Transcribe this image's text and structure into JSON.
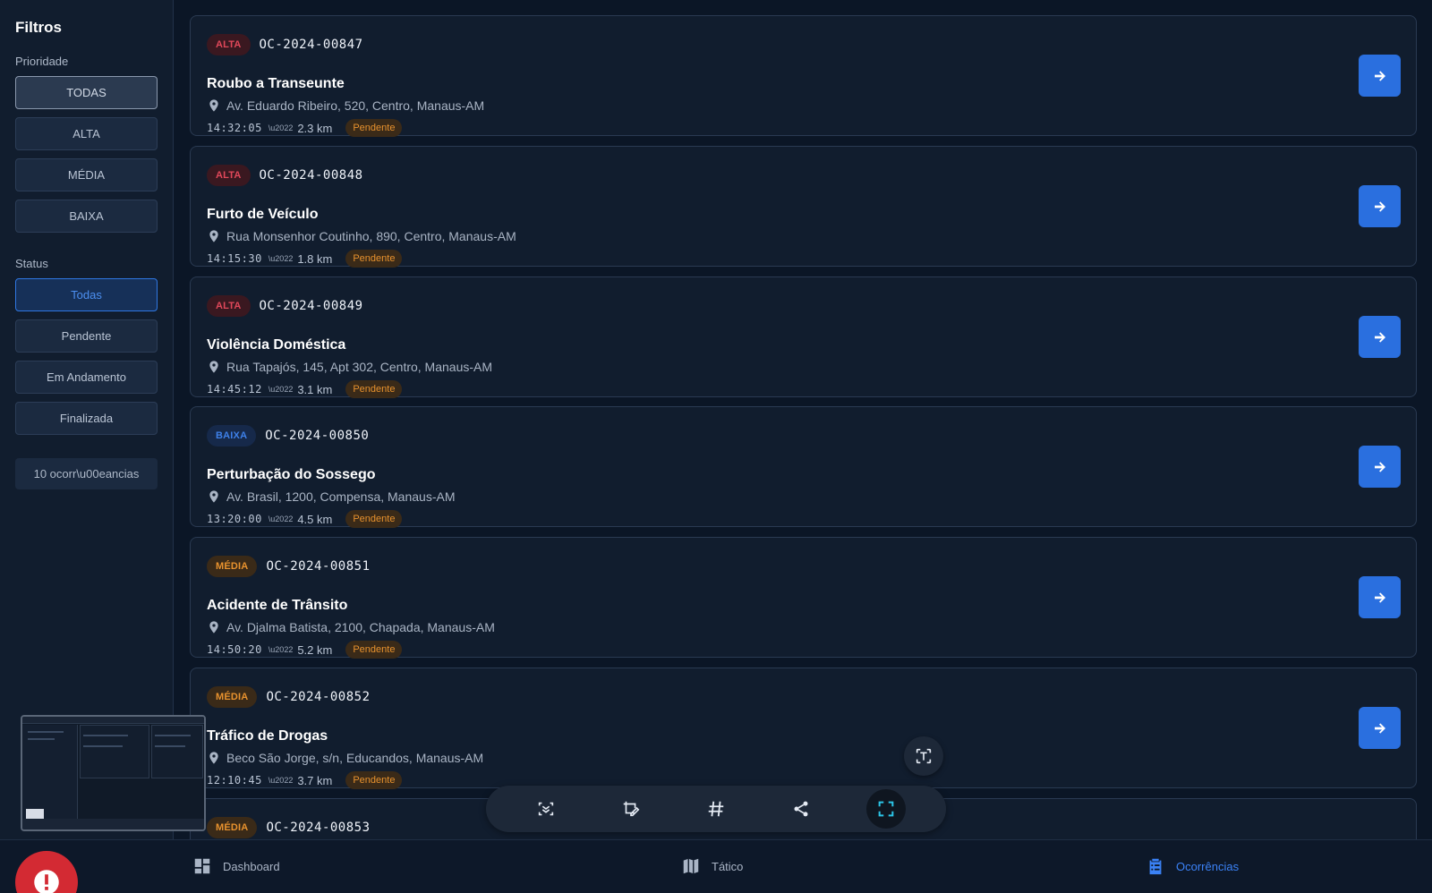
{
  "sidebar": {
    "title": "Filtros",
    "priority_label": "Prioridade",
    "priority_options": [
      "TODAS",
      "ALTA",
      "MÉDIA",
      "BAIXA"
    ],
    "status_label": "Status",
    "status_options": [
      "Todas",
      "Pendente",
      "Em Andamento",
      "Finalizada"
    ],
    "count": "10 ocorr\\u00eancias"
  },
  "occurrences": [
    {
      "priority": "ALTA",
      "code": "OC-2024-00847",
      "title": "Roubo a Transeunte",
      "address": "Av. Eduardo Ribeiro, 520, Centro, Manaus-AM",
      "time": "14:32:05",
      "sep": "\\u2022",
      "distance": "2.3 km",
      "status": "Pendente"
    },
    {
      "priority": "ALTA",
      "code": "OC-2024-00848",
      "title": "Furto de Veículo",
      "address": "Rua Monsenhor Coutinho, 890, Centro, Manaus-AM",
      "time": "14:15:30",
      "sep": "\\u2022",
      "distance": "1.8 km",
      "status": "Pendente"
    },
    {
      "priority": "ALTA",
      "code": "OC-2024-00849",
      "title": "Violência Doméstica",
      "address": "Rua Tapajós, 145, Apt 302, Centro, Manaus-AM",
      "time": "14:45:12",
      "sep": "\\u2022",
      "distance": "3.1 km",
      "status": "Pendente"
    },
    {
      "priority": "BAIXA",
      "code": "OC-2024-00850",
      "title": "Perturbação do Sossego",
      "address": "Av. Brasil, 1200, Compensa, Manaus-AM",
      "time": "13:20:00",
      "sep": "\\u2022",
      "distance": "4.5 km",
      "status": "Pendente"
    },
    {
      "priority": "MÉDIA",
      "code": "OC-2024-00851",
      "title": "Acidente de Trânsito",
      "address": "Av. Djalma Batista, 2100, Chapada, Manaus-AM",
      "time": "14:50:20",
      "sep": "\\u2022",
      "distance": "5.2 km",
      "status": "Pendente"
    },
    {
      "priority": "MÉDIA",
      "code": "OC-2024-00852",
      "title": "Tráfico de Drogas",
      "address": "Beco São Jorge, s/n, Educandos, Manaus-AM",
      "time": "12:10:45",
      "sep": "\\u2022",
      "distance": "3.7 km",
      "status": "Pendente"
    },
    {
      "priority": "MÉDIA",
      "code": "OC-2024-00853",
      "title": "",
      "address": "",
      "time": "",
      "sep": "",
      "distance": "",
      "status": ""
    }
  ],
  "nav": {
    "dashboard": "Dashboard",
    "tactical": "Tático",
    "occurrences": "Ocorrências"
  },
  "colors": {
    "accent": "#2a6fdf",
    "alta": "#e0485a",
    "media": "#e8922e",
    "baixa": "#3e80e8",
    "alert": "#d32a33"
  }
}
